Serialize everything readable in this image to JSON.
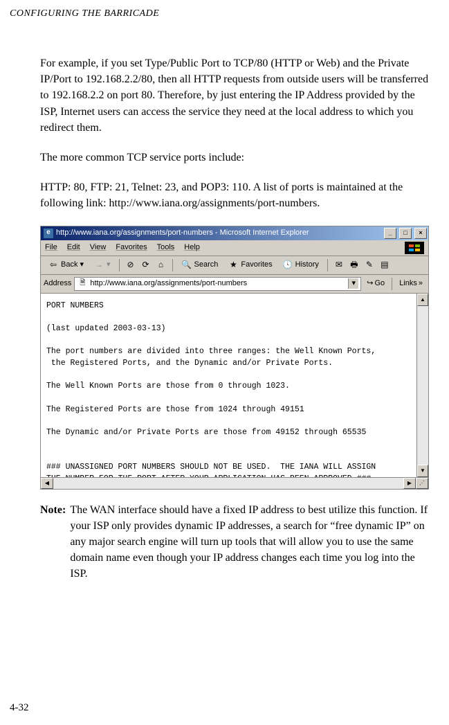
{
  "header": "CONFIGURING THE BARRICADE",
  "para1": "For example, if you set Type/Public Port to TCP/80 (HTTP or Web) and the Private IP/Port to 192.168.2.2/80, then all HTTP requests from outside users will be transferred to 192.168.2.2 on port 80. Therefore, by just entering the IP Address provided by the ISP, Internet users can access the service they need at the local address to which you redirect them.",
  "para2": "The more common TCP service ports include:",
  "para3": "HTTP: 80, FTP: 21, Telnet: 23, and POP3: 110. A list of ports is maintained at the following link: http://www.iana.org/assignments/port-numbers.",
  "browser": {
    "title": "http://www.iana.org/assignments/port-numbers - Microsoft Internet Explorer",
    "menu": {
      "file": "File",
      "edit": "Edit",
      "view": "View",
      "favorites": "Favorites",
      "tools": "Tools",
      "help": "Help"
    },
    "toolbar": {
      "back": "Back",
      "search": "Search",
      "favorites": "Favorites",
      "history": "History"
    },
    "address_label": "Address",
    "address_value": "http://www.iana.org/assignments/port-numbers",
    "go": "Go",
    "links": "Links",
    "content": "PORT NUMBERS\n\n(last updated 2003-03-13)\n\nThe port numbers are divided into three ranges: the Well Known Ports,\n the Registered Ports, and the Dynamic and/or Private Ports.\n\nThe Well Known Ports are those from 0 through 1023.\n\nThe Registered Ports are those from 1024 through 49151\n\nThe Dynamic and/or Private Ports are those from 49152 through 65535\n\n\n### UNASSIGNED PORT NUMBERS SHOULD NOT BE USED.  THE IANA WILL ASSIGN\nTHE NUMBER FOR THE PORT AFTER YOUR APPLICATION HAS BEEN APPROVED ###"
  },
  "note": {
    "label": "Note:",
    "text": "The WAN interface should have a fixed IP address to best utilize this function. If your ISP only provides dynamic IP addresses, a search for “free dynamic IP” on any major search engine will turn up tools that will allow you to use the same domain name even though your IP address changes each time you log into the ISP."
  },
  "page_number": "4-32"
}
